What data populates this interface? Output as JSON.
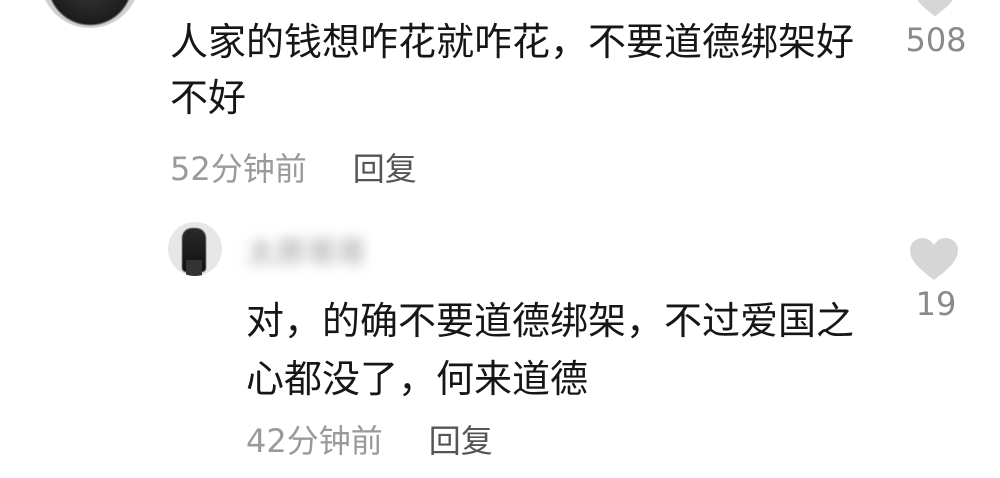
{
  "comment": {
    "text": "人家的钱想咋花就咋花，不要道德绑架好不好",
    "timestamp": "52分钟前",
    "reply_label": "回复",
    "like_count": "508",
    "like_icon": "heart-icon"
  },
  "reply": {
    "username": "太原哥哥",
    "text": "对，的确不要道德绑架，不过爱国之心都没了，何来道德",
    "timestamp": "42分钟前",
    "reply_label": "回复",
    "like_count": "19",
    "like_icon": "heart-icon"
  },
  "colors": {
    "heart": "#d6d6d6",
    "meta_text": "#9a9a9a",
    "reply_link": "#555555",
    "body_text": "#161616"
  }
}
